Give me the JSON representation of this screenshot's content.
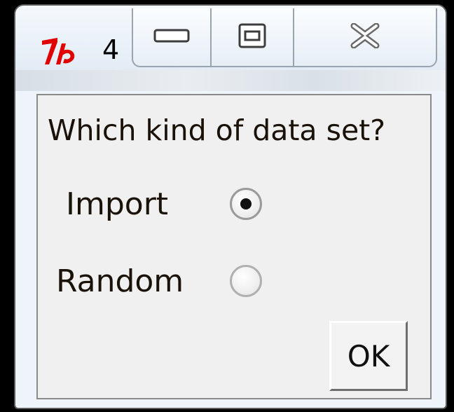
{
  "window": {
    "title": "4",
    "app_icon": "tk-feather-icon",
    "caption_buttons": [
      "minimize-icon",
      "maximize-icon",
      "close-icon"
    ]
  },
  "dialog": {
    "question": "Which kind of data set?",
    "options": [
      {
        "label": "Import",
        "selected": true
      },
      {
        "label": "Random",
        "selected": false
      }
    ],
    "ok_label": "OK"
  },
  "colors": {
    "icon_red": "#e00000",
    "dialog_bg": "#f0f0f0",
    "text": "#1a1208"
  }
}
